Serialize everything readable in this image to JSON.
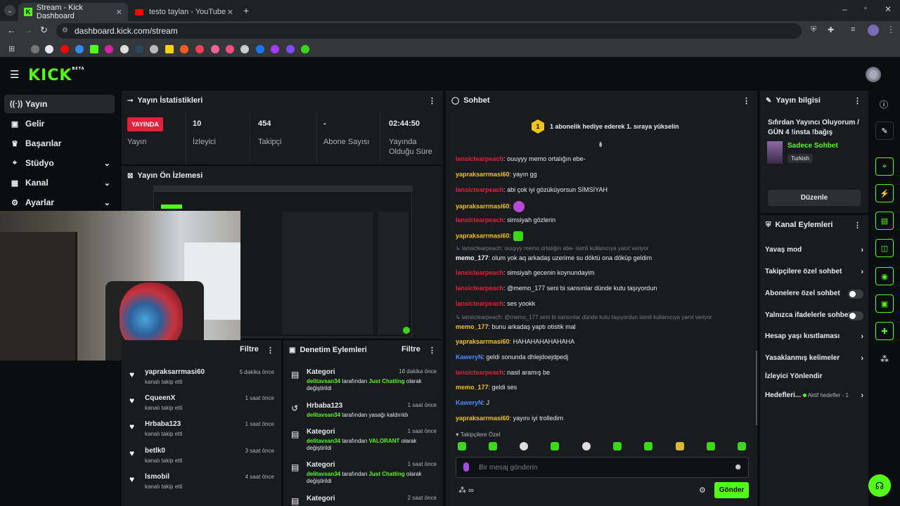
{
  "browser": {
    "tabs": [
      {
        "label": "Stream - Kick Dashboard"
      },
      {
        "label": "testo taylan - YouTube"
      }
    ],
    "url": "dashboard.kick.com/stream"
  },
  "app": {
    "logo": "KICK",
    "logo_badge": "BETA"
  },
  "sidebar": {
    "items": [
      {
        "label": "Yayın"
      },
      {
        "label": "Gelir"
      },
      {
        "label": "Başarılar"
      },
      {
        "label": "Stüdyo"
      },
      {
        "label": "Kanal"
      },
      {
        "label": "Ayarlar"
      }
    ]
  },
  "stats": {
    "title": "Yayın İstatistikleri",
    "live_badge": "YAYINDA",
    "live_label": "Yayın",
    "viewers": {
      "value": "10",
      "label": "İzleyici"
    },
    "followers": {
      "value": "454",
      "label": "Takipçi"
    },
    "subs": {
      "value": "-",
      "label": "Abone Sayısı"
    },
    "duration": {
      "value": "02:44:50",
      "label": "Yayında Olduğu Süre"
    }
  },
  "preview": {
    "title": "Yayın Ön İzlemesi"
  },
  "activity": {
    "filter": "Filtre",
    "items": [
      {
        "name": "yapraksarrmasi60",
        "sub": "kanalı takip etti",
        "time": "5 dakika önce"
      },
      {
        "name": "CqueenX",
        "sub": "kanalı takip etti",
        "time": "1 saat önce"
      },
      {
        "name": "Hrbaba123",
        "sub": "kanalı takip etti",
        "time": "1 saat önce"
      },
      {
        "name": "betlk0",
        "sub": "kanalı takip etti",
        "time": "3 saat önce"
      },
      {
        "name": "lsmobil",
        "sub": "kanalı takip etti",
        "time": "4 saat önce"
      }
    ]
  },
  "moderation": {
    "title": "Denetim Eylemleri",
    "filter": "Filtre",
    "items": [
      {
        "title": "Kategori",
        "user": "delitavsan34",
        "pre": "tarafından",
        "target": "Just Chatting",
        "post": "olarak değiştirildi",
        "time": "18 dakika önce"
      },
      {
        "title": "Hrbaba123",
        "user": "delitavsan34",
        "pre": "tarafından yasağı kaldırıldı",
        "target": "",
        "post": "",
        "time": "1 saat önce"
      },
      {
        "title": "Kategori",
        "user": "delitavsan34",
        "pre": "tarafından",
        "target": "VALORANT",
        "post": "olarak değiştirildi",
        "time": "1 saat önce"
      },
      {
        "title": "Kategori",
        "user": "delitavsan34",
        "pre": "tarafından",
        "target": "Just Chatting",
        "post": "olarak değiştirildi",
        "time": "1 saat önce"
      },
      {
        "title": "Kategori",
        "user": "",
        "pre": "",
        "target": "",
        "post": "",
        "time": "2 saat önce"
      }
    ]
  },
  "chat": {
    "title": "Sohbet",
    "gift_banner": "1 abonelik hediye ederek 1. sıraya yükselin",
    "gift_rank": "1",
    "messages": [
      {
        "user": "lansictearpeach",
        "color": "red",
        "text": "ouuyyy memo ortalığın ebe-"
      },
      {
        "user": "yapraksarrmasi60",
        "color": "yellow",
        "text": "yayın gg"
      },
      {
        "user": "lansictearpeach",
        "color": "red",
        "text": "abi çok iyi gözüküyorsun SİMSİYAH"
      },
      {
        "user": "yapraksarrmasi60",
        "color": "yellow",
        "text": ""
      },
      {
        "user": "lansictearpeach",
        "color": "red",
        "text": "simsiyah gözlerin"
      },
      {
        "user": "yapraksarrmasi60",
        "color": "yellow",
        "text": ""
      },
      {
        "user": "memo_177",
        "color": "white",
        "text": "olum yok aq arkadaş uzerime su döktü ona döküp geldim",
        "reply": "lansictearpeach: ouuyyy memo ortalığın ebe- isimli kullanıcıya yanıt veriyor"
      },
      {
        "user": "lansictearpeach",
        "color": "red",
        "text": "simsiyah gecenin koynundayim"
      },
      {
        "user": "lansictearpeach",
        "color": "red",
        "text": "@memo_177 seni bi sansınlar dünde kutu taşıyordun"
      },
      {
        "user": "lansictearpeach",
        "color": "red",
        "text": "ses yookk"
      },
      {
        "user": "memo_177",
        "color": "white",
        "text": "bunu arkadaş yaptı otistik mal",
        "reply": "lansictearpeach: @memo_177 seni bi sansınlar dünde kutu taşıyordun isimli kullanıcıya yanıt veriyor"
      },
      {
        "user": "yapraksarrmasi60",
        "color": "yellow",
        "text": "HAHAHAHAHAHAHA"
      },
      {
        "user": "KaweryN",
        "color": "blue",
        "text": "geldi sonunda dhlejdoejdpedj"
      },
      {
        "user": "lansictearpeach",
        "color": "red",
        "text": "nasil aramış be"
      },
      {
        "user": "memo_177",
        "color": "yellow",
        "text": "geldi ses"
      },
      {
        "user": "KaweryN",
        "color": "blue",
        "text": "J"
      },
      {
        "user": "yapraksarrmasi60",
        "color": "yellow",
        "text": "yayını iyi trolledim"
      }
    ],
    "emote_label": "Takipçilere Özel",
    "input_placeholder": "Bir mesaj gönderin",
    "send_button": "Gönder"
  },
  "stream_info": {
    "title": "Yayın bilgisi",
    "stream_title": "Sıfırdan Yayıncı Oluyorum / GÜN 4 !insta !bağış",
    "category": "Sadece Sohbet",
    "language": "Turkish",
    "edit_button": "Düzenle"
  },
  "channel_actions": {
    "title": "Kanal Eylemleri",
    "items": [
      {
        "label": "Yavaş mod",
        "kind": "chevron"
      },
      {
        "label": "Takipçilere özel sohbet",
        "kind": "chevron"
      },
      {
        "label": "Abonelere özel sohbet",
        "kind": "toggle"
      },
      {
        "label": "Yalnızca ifadelerle sohbet",
        "kind": "toggle"
      },
      {
        "label": "Hesap yaşı kısıtlaması",
        "kind": "chevron"
      },
      {
        "label": "Yasaklanmış kelimeler",
        "kind": "chevron"
      },
      {
        "label": "İzleyici Yönlendir",
        "kind": "none"
      },
      {
        "label": "Hedefleri...",
        "kind": "chevron",
        "extra": "Aktif hedefler - 1"
      }
    ]
  },
  "colors": {
    "accent": "#53fc18",
    "live": "#e5203b",
    "panel": "#191b1f",
    "bg": "#0b0e0f"
  }
}
